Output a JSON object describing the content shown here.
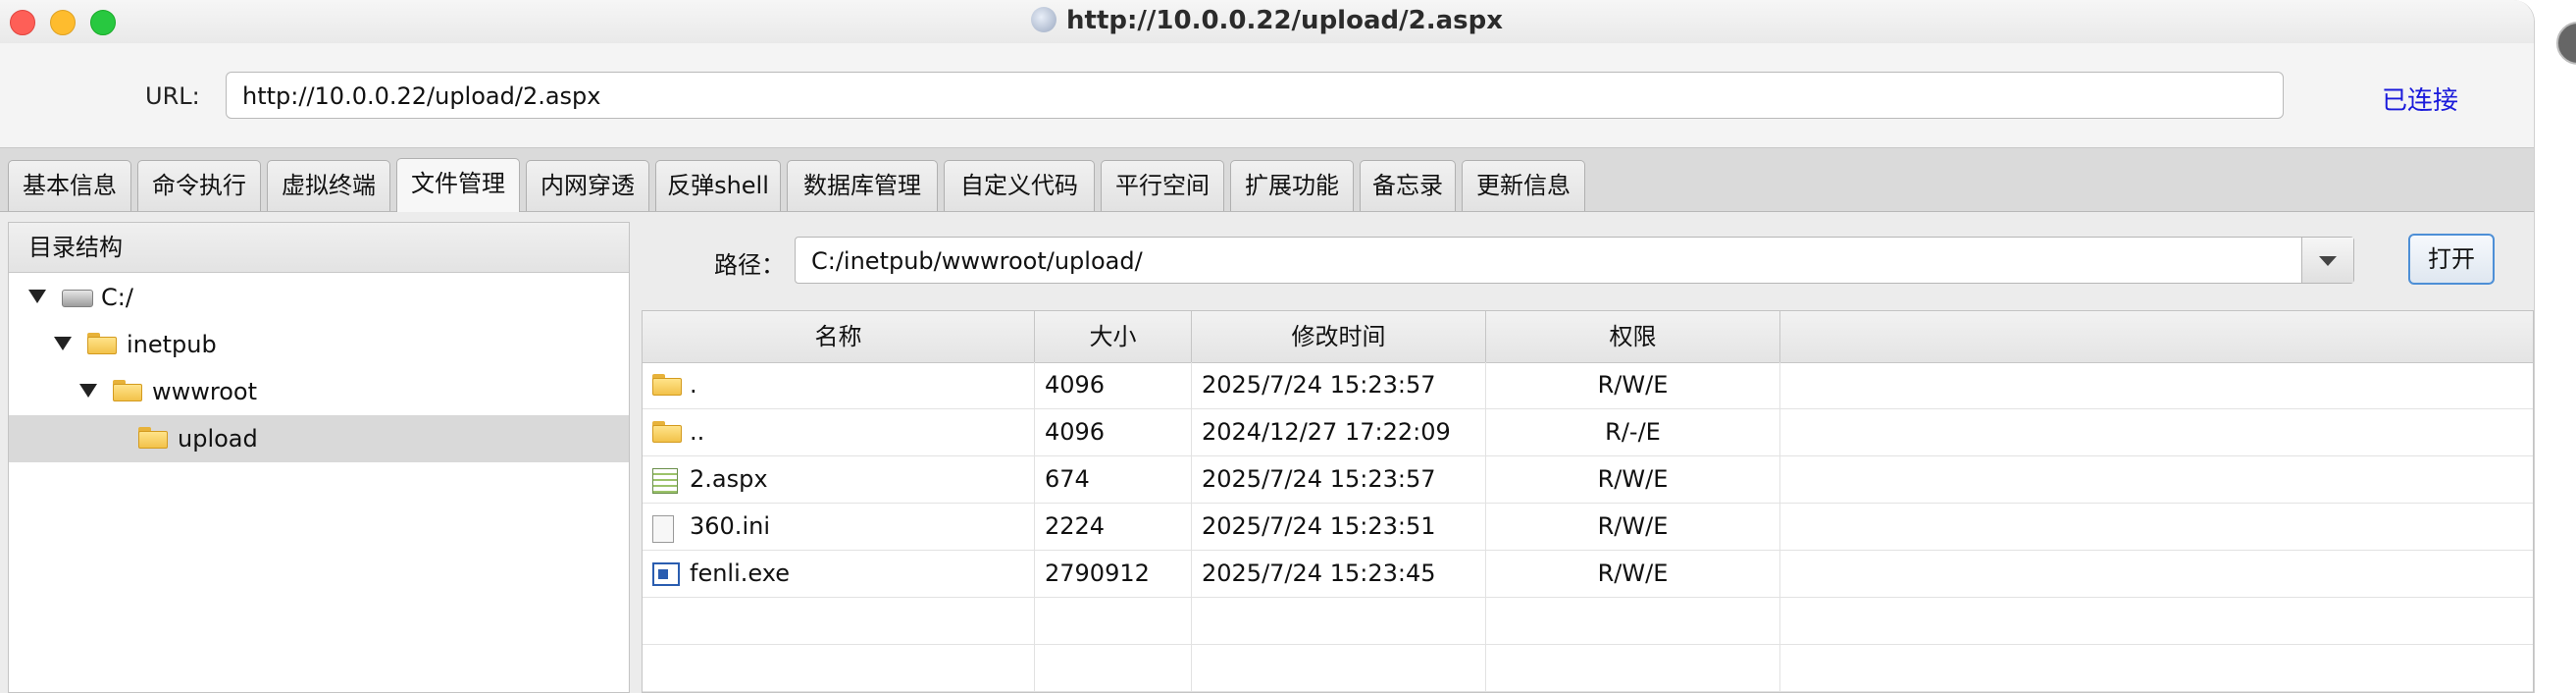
{
  "window": {
    "title": "http://10.0.0.22/upload/2.aspx"
  },
  "url_bar": {
    "label": "URL:",
    "value": "http://10.0.0.22/upload/2.aspx",
    "status": "已连接",
    "status_color": "#1a1adb"
  },
  "tabs": [
    "基本信息",
    "命令执行",
    "虚拟终端",
    "文件管理",
    "内网穿透",
    "反弹shell",
    "数据库管理",
    "自定义代码",
    "平行空间",
    "扩展功能",
    "备忘录",
    "更新信息"
  ],
  "active_tab": "文件管理",
  "tree": {
    "header": "目录结构",
    "nodes": [
      {
        "label": "C:/",
        "icon": "drive-icon",
        "expanded": true
      },
      {
        "label": "inetpub",
        "icon": "folder-icon",
        "expanded": true
      },
      {
        "label": "wwwroot",
        "icon": "folder-icon",
        "expanded": true
      },
      {
        "label": "upload",
        "icon": "folder-icon",
        "selected": true
      }
    ]
  },
  "path": {
    "label": "路径：",
    "value": "C:/inetpub/wwwroot/upload/"
  },
  "open_button": "打开",
  "file_table": {
    "columns": [
      "名称",
      "大小",
      "修改时间",
      "权限"
    ],
    "rows": [
      {
        "name": ".",
        "size": "4096",
        "modified": "2025/7/24 15:23:57",
        "perm": "R/W/E",
        "icon": "folder-icon"
      },
      {
        "name": "..",
        "size": "4096",
        "modified": "2024/12/27 17:22:09",
        "perm": "R/-/E",
        "icon": "folder-icon"
      },
      {
        "name": "2.aspx",
        "size": "674",
        "modified": "2025/7/24 15:23:57",
        "perm": "R/W/E",
        "icon": "aspx-file-icon"
      },
      {
        "name": "360.ini",
        "size": "2224",
        "modified": "2025/7/24 15:23:51",
        "perm": "R/W/E",
        "icon": "ini-file-icon"
      },
      {
        "name": "fenli.exe",
        "size": "2790912",
        "modified": "2025/7/24 15:23:45",
        "perm": "R/W/E",
        "icon": "exe-file-icon"
      }
    ]
  }
}
